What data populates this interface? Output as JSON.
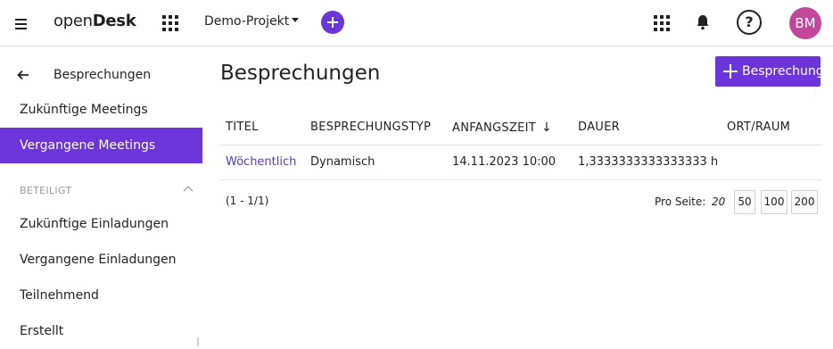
{
  "header": {
    "logo_prefix": "open",
    "logo_suffix": "Desk",
    "project": "Demo-Projekt",
    "avatar_initials": "BM",
    "help_label": "?",
    "accent_color": "#6b35d9",
    "avatar_color": "#c2469a"
  },
  "sidebar": {
    "title": "Besprechungen",
    "items": [
      {
        "label": "Zukünftige Meetings"
      },
      {
        "label": "Vergangene Meetings"
      }
    ],
    "section_label": "BETEILIGT",
    "section_items": [
      {
        "label": "Zukünftige Einladungen"
      },
      {
        "label": "Vergangene Einladungen"
      },
      {
        "label": "Teilnehmend"
      },
      {
        "label": "Erstellt"
      }
    ]
  },
  "main": {
    "title": "Besprechungen",
    "new_button_label": "Besprechung",
    "columns": [
      "TITEL",
      "BESPRECHUNGSTYP",
      "ANFANGSZEIT",
      "DAUER",
      "ORT/RAUM"
    ],
    "sort_indicator": "↓",
    "rows": [
      {
        "title": "Wöchentlich",
        "type": "Dynamisch",
        "start": "14.11.2023 10:00",
        "duration": "1,3333333333333333 h",
        "location": ""
      }
    ],
    "pagination": {
      "count": "(1 - 1/1)",
      "per_page_label": "Pro Seite:",
      "current": "20",
      "options": [
        "50",
        "100",
        "200"
      ]
    }
  }
}
